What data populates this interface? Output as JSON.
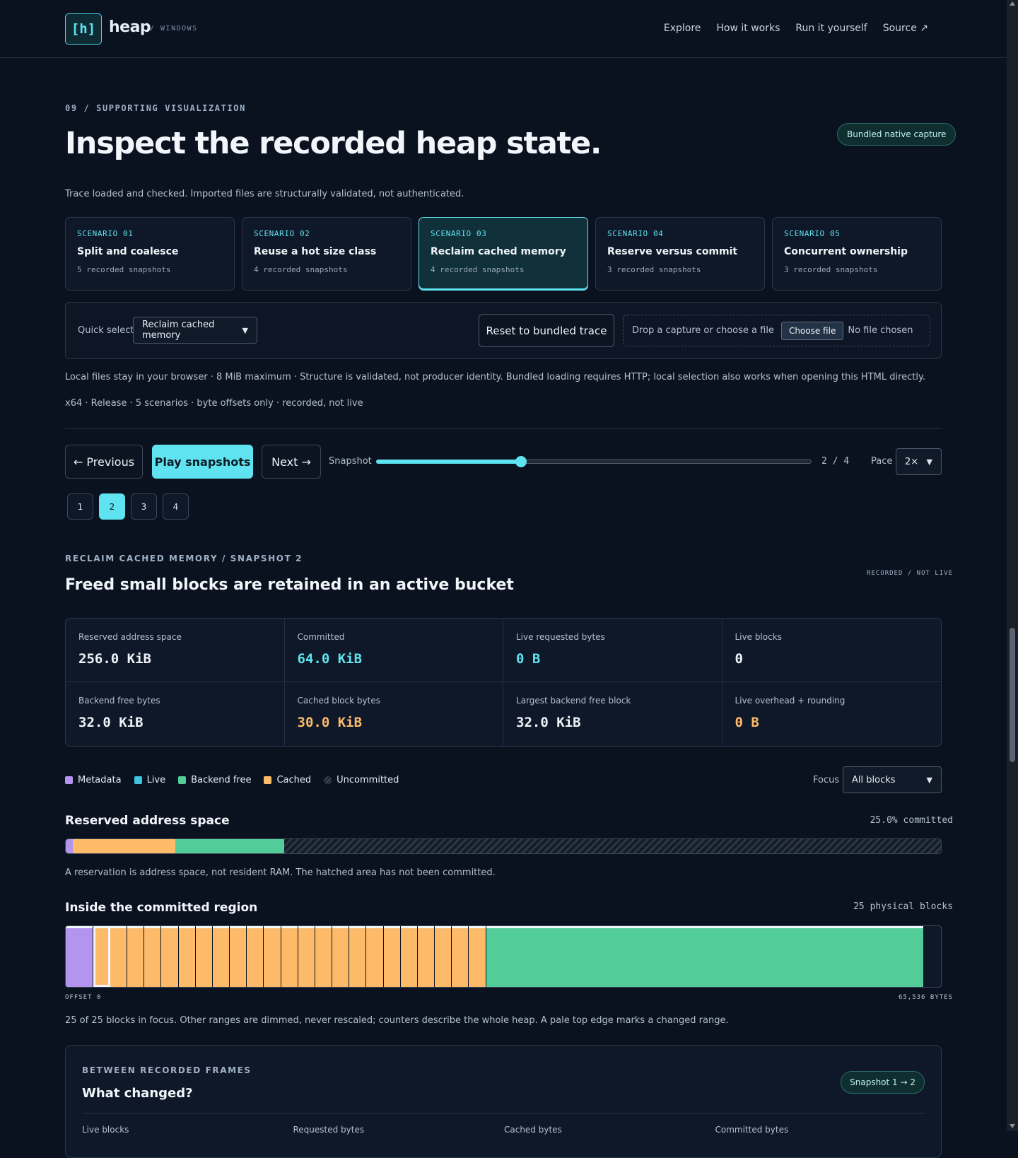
{
  "header": {
    "logo": "[h]",
    "brand": "heap",
    "brand_sub": "/ WINDOWS",
    "nav": [
      "Explore",
      "How it works",
      "Run it yourself",
      "Source ↗"
    ]
  },
  "section": {
    "eyebrow": "09 / SUPPORTING VISUALIZATION",
    "title": "Inspect the recorded heap state.",
    "badge": "Bundled native capture",
    "status": "Trace loaded and checked. Imported files are structurally validated, not authenticated."
  },
  "scenarios": [
    {
      "tag": "SCENARIO 01",
      "name": "Split and coalesce",
      "snaps": "5 recorded snapshots"
    },
    {
      "tag": "SCENARIO 02",
      "name": "Reuse a hot size class",
      "snaps": "4 recorded snapshots"
    },
    {
      "tag": "SCENARIO 03",
      "name": "Reclaim cached memory",
      "snaps": "4 recorded snapshots"
    },
    {
      "tag": "SCENARIO 04",
      "name": "Reserve versus commit",
      "snaps": "3 recorded snapshots"
    },
    {
      "tag": "SCENARIO 05",
      "name": "Concurrent ownership",
      "snaps": "3 recorded snapshots"
    }
  ],
  "controls": {
    "quick_select_label": "Quick select",
    "quick_select_value": "Reclaim cached memory",
    "reset": "Reset to bundled trace",
    "drop_text": "Drop a capture or choose a file",
    "choose_file": "Choose file",
    "no_file": "No file chosen"
  },
  "notes": {
    "local": "Local files stay in your browser · 8 MiB maximum · Structure is validated, not producer identity. Bundled loading requires HTTP; local selection also works when opening this HTML directly.",
    "meta": "x64 · Release · 5 scenarios · byte offsets only · recorded, not live"
  },
  "player": {
    "prev": "← Previous",
    "play": "Play snapshots",
    "next": "Next →",
    "snapshot_label": "Snapshot",
    "snapshot_value": 2,
    "snapshot_total": 4,
    "snapshot_count": "2 / 4",
    "pace_label": "Pace",
    "pace_value": "2×",
    "chips": [
      "1",
      "2",
      "3",
      "4"
    ]
  },
  "snapshot": {
    "eyebrow": "RECLAIM CACHED MEMORY / SNAPSHOT 2",
    "title": "Freed small blocks are retained in an active bucket",
    "rec_tag": "RECORDED / NOT LIVE"
  },
  "metrics": [
    {
      "label": "Reserved address space",
      "value": "256.0 KiB",
      "tone": ""
    },
    {
      "label": "Committed",
      "value": "64.0 KiB",
      "tone": "cyan"
    },
    {
      "label": "Live requested bytes",
      "value": "0 B",
      "tone": "cyan"
    },
    {
      "label": "Live blocks",
      "value": "0",
      "tone": ""
    },
    {
      "label": "Backend free bytes",
      "value": "32.0 KiB",
      "tone": ""
    },
    {
      "label": "Cached block bytes",
      "value": "30.0 KiB",
      "tone": "orange"
    },
    {
      "label": "Largest backend free block",
      "value": "32.0 KiB",
      "tone": ""
    },
    {
      "label": "Live overhead + rounding",
      "value": "0 B",
      "tone": "orange"
    }
  ],
  "legend": [
    {
      "name": "Metadata",
      "color": "#b394ee"
    },
    {
      "name": "Live",
      "color": "#3cc4e0"
    },
    {
      "name": "Backend free",
      "color": "#52cd9a"
    },
    {
      "name": "Cached",
      "color": "#fdbb6a"
    },
    {
      "name": "Uncommitted",
      "color": "hatch"
    }
  ],
  "focus": {
    "label": "Focus",
    "value": "All blocks"
  },
  "reserved": {
    "title": "Reserved address space",
    "committed_text": "25.0% committed",
    "segments": [
      {
        "kind": "metadata",
        "fraction": 0.0078,
        "color": "#b394ee"
      },
      {
        "kind": "cached",
        "fraction": 0.1172,
        "color": "#fdbb6a"
      },
      {
        "kind": "backend-free",
        "fraction": 0.125,
        "color": "#52cd9a"
      }
    ],
    "note": "A reservation is address space, not resident RAM. The hatched area has not been committed."
  },
  "committed": {
    "title": "Inside the committed region",
    "count_text": "25 physical blocks",
    "total_bytes": 65536,
    "blocks": [
      {
        "kind": "metadata",
        "bytes": 2048
      },
      {
        "kind": "cached",
        "bytes": 1280,
        "selected": true
      },
      {
        "kind": "cached",
        "bytes": 1280
      },
      {
        "kind": "cached",
        "bytes": 1280
      },
      {
        "kind": "cached",
        "bytes": 1280
      },
      {
        "kind": "cached",
        "bytes": 1280
      },
      {
        "kind": "cached",
        "bytes": 1280
      },
      {
        "kind": "cached",
        "bytes": 1280
      },
      {
        "kind": "cached",
        "bytes": 1280
      },
      {
        "kind": "cached",
        "bytes": 1280
      },
      {
        "kind": "cached",
        "bytes": 1280
      },
      {
        "kind": "cached",
        "bytes": 1280
      },
      {
        "kind": "cached",
        "bytes": 1280
      },
      {
        "kind": "cached",
        "bytes": 1280
      },
      {
        "kind": "cached",
        "bytes": 1280
      },
      {
        "kind": "cached",
        "bytes": 1280
      },
      {
        "kind": "cached",
        "bytes": 1280
      },
      {
        "kind": "cached",
        "bytes": 1280
      },
      {
        "kind": "cached",
        "bytes": 1280
      },
      {
        "kind": "cached",
        "bytes": 1280
      },
      {
        "kind": "cached",
        "bytes": 1280
      },
      {
        "kind": "cached",
        "bytes": 1280
      },
      {
        "kind": "cached",
        "bytes": 1280
      },
      {
        "kind": "cached",
        "bytes": 1280
      },
      {
        "kind": "backend-free",
        "bytes": 32768
      }
    ],
    "axis_left": "OFFSET 0",
    "axis_right": "65,536 BYTES",
    "note": "25 of 25 blocks in focus. Other ranges are dimmed, never rescaled; counters describe the whole heap. A pale top edge marks a changed range."
  },
  "between": {
    "eyebrow": "BETWEEN RECORDED FRAMES",
    "title": "What changed?",
    "pill": "Snapshot 1 → 2",
    "columns": [
      "Live blocks",
      "Requested bytes",
      "Cached bytes",
      "Committed bytes"
    ]
  }
}
